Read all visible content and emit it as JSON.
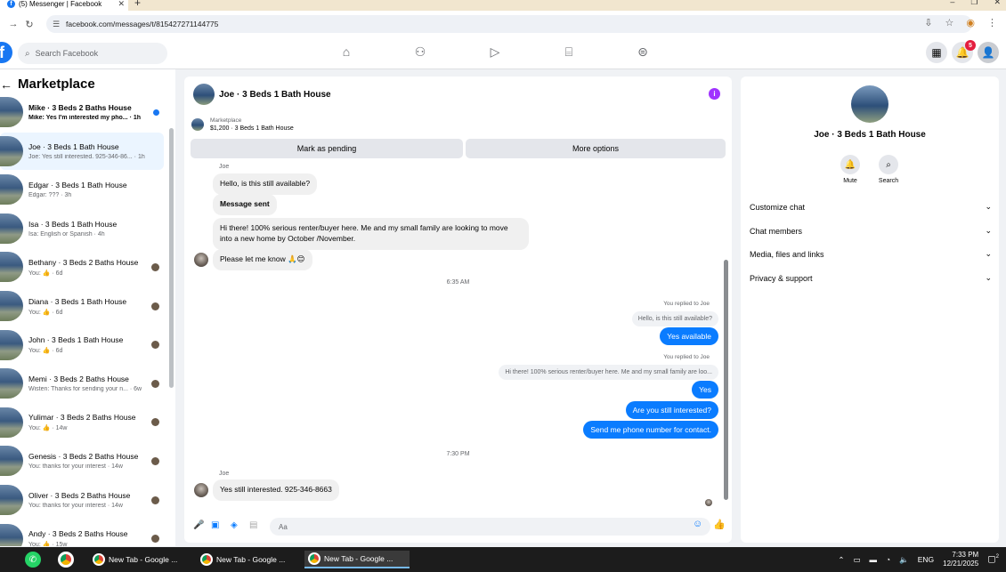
{
  "browser": {
    "tab_title": "(5) Messenger | Facebook",
    "new_tab_icon": "+",
    "url": "facebook.com/messages/t/8154272711447​75",
    "window_controls": [
      "–",
      "❐",
      "✕"
    ]
  },
  "header": {
    "logo": "f",
    "search_placeholder": "Search Facebook",
    "notification_count": "5"
  },
  "sidebar": {
    "title": "Marketplace",
    "conversations": [
      {
        "name": "Mike · 3 Beds 2 Baths House",
        "preview": "Mike: Yes I'm interested my pho... · 1h",
        "unread": true
      },
      {
        "name": "Joe · 3 Beds 1 Bath House",
        "preview": "Joe: Yes still interested. 925-346-86... · 1h",
        "active": true
      },
      {
        "name": "Edgar · 3 Beds 1 Bath House",
        "preview": "Edgar: ??? · 3h"
      },
      {
        "name": "Isa · 3 Beds 1 Bath House",
        "preview": "Isa: English or Spanish · 4h"
      },
      {
        "name": "Bethany · 3 Beds 2 Baths House",
        "preview": "You: 👍 · 6d"
      },
      {
        "name": "Diana · 3 Beds 1 Bath House",
        "preview": "You: 👍 · 6d"
      },
      {
        "name": "John · 3 Beds 1 Bath House",
        "preview": "You: 👍 · 6d"
      },
      {
        "name": "Memi · 3 Beds 2 Baths House",
        "preview": "Wisten: Thanks for sending your n... · 6w"
      },
      {
        "name": "Yulimar · 3 Beds 2 Baths House",
        "preview": "You: 👍 · 14w"
      },
      {
        "name": "Genesis · 3 Beds 2 Baths House",
        "preview": "You: thanks for your interest · 14w"
      },
      {
        "name": "Oliver · 3 Beds 2 Baths House",
        "preview": "You: thanks for your interest · 14w"
      },
      {
        "name": "Andy · 3 Beds 2 Baths House",
        "preview": "You: 👍 · 15w"
      }
    ]
  },
  "chat": {
    "title": "Joe · 3 Beds 1 Bath House",
    "marketplace_label": "Marketplace",
    "listing": "$1,200 · 3 Beds 1 Bath House",
    "mark_pending": "Mark as pending",
    "more_options": "More options",
    "sender_name": "Joe",
    "msg_1": "Hello, is this still available?",
    "msg_2": "Message sent",
    "msg_3": "Hi there! 100% serious renter/buyer here. Me and my small family are looking to move into a new home by October /November.",
    "msg_4": "Please let me know 🙏😊",
    "time_1": "6:35 AM",
    "replied_1": "You replied to Joe",
    "ref_1": "Hello, is this still available?",
    "out_1": "Yes available",
    "replied_2": "You replied to Joe",
    "ref_2": "Hi there! 100% serious renter/buyer here. Me and my small family are loo...",
    "out_2": "Yes",
    "out_3": "Are you still interested?",
    "out_4": "Send me phone number for contact.",
    "time_2": "7:30 PM",
    "sender_name_2": "Joe",
    "msg_5": "Yes still interested. 925-346-8663",
    "composer_placeholder": "Aa"
  },
  "right_panel": {
    "title": "Joe · 3 Beds 1 Bath House",
    "mute": "Mute",
    "search": "Search",
    "rows": [
      "Customize chat",
      "Chat members",
      "Media, files and links",
      "Privacy & support"
    ]
  },
  "taskbar": {
    "apps": [
      "New Tab - Google ...",
      "New Tab - Google ...",
      "New Tab - Google ..."
    ],
    "lang": "ENG",
    "time": "7:33 PM",
    "date": "12/21/2025",
    "notif": "2"
  }
}
